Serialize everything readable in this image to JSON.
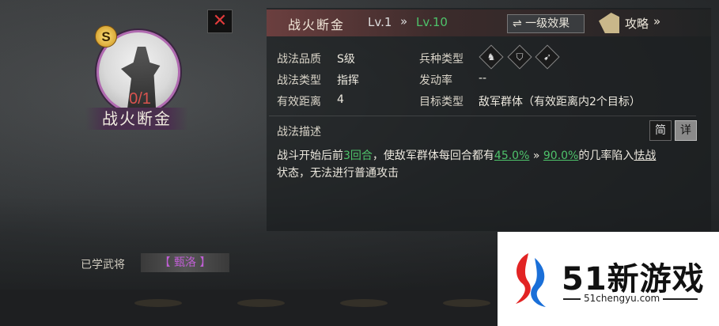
{
  "skill": {
    "rank": "S",
    "count": "0/1",
    "name": "战火断金",
    "close_icon": "close-icon"
  },
  "header": {
    "title": "战火断金",
    "level_current": "Lv.1",
    "arrow": "»",
    "level_max": "Lv.10",
    "effect_button": "⇌ 一级效果",
    "guide_label": "攻略",
    "guide_arrow": "»"
  },
  "attributes": {
    "quality_label": "战法品质",
    "quality_value": "S级",
    "type_label": "战法类型",
    "type_value": "指挥",
    "range_label": "有效距离",
    "range_value": "4",
    "troop_label": "兵种类型",
    "troop_icons": [
      "cavalry-icon",
      "shield-icon",
      "archer-icon"
    ],
    "rate_label": "发动率",
    "rate_value": "--",
    "target_label": "目标类型",
    "target_value": "敌军群体（有效距离内2个目标）"
  },
  "description": {
    "title": "战法描述",
    "tab_brief": "简",
    "tab_detail": "详",
    "text_part1": "战斗开始后前",
    "text_rounds": "3回合",
    "text_part2": "，使敌军群体每回合都有",
    "text_rate1": "45.0%",
    "text_arrow": " » ",
    "text_rate2": "90.0%",
    "text_part3": "的几率陷入",
    "text_status": "怯战",
    "text_part4": "状态，无法进行普通攻击"
  },
  "learned": {
    "label": "已学武将",
    "value": "【 甄洛 】"
  },
  "watermark": {
    "brand": "51新游戏",
    "url": "51chengyu.com"
  },
  "colors": {
    "accent_green": "#4ec26a",
    "danger_red": "#d9534f",
    "purple": "#c15fd6"
  }
}
